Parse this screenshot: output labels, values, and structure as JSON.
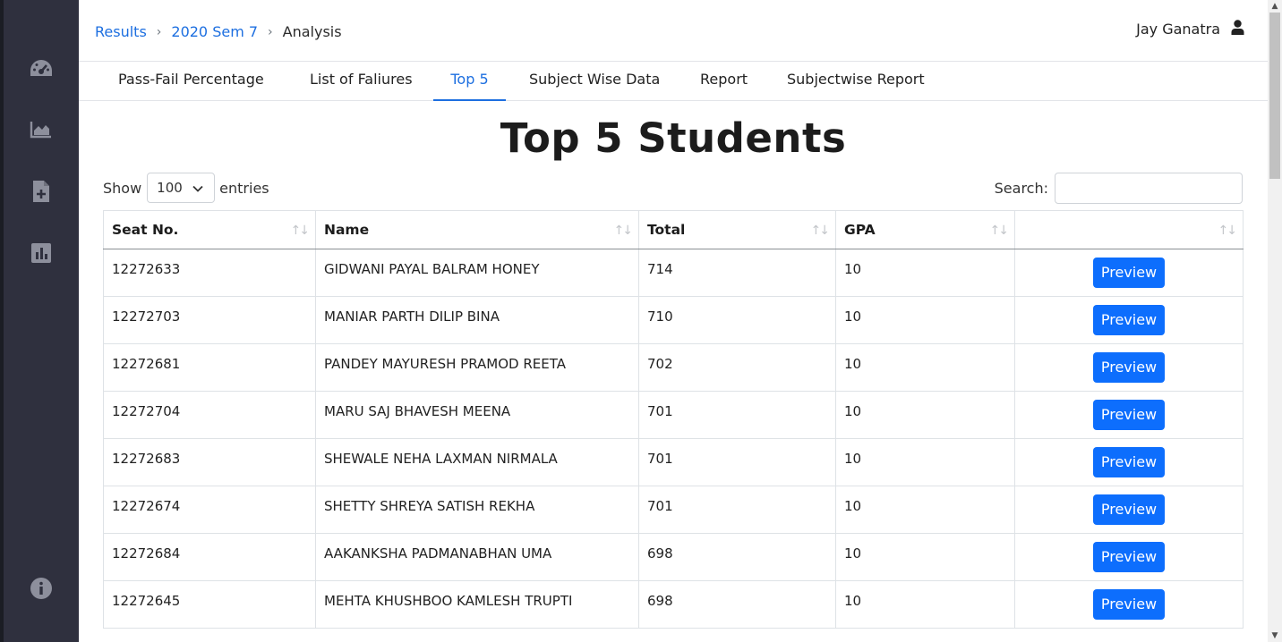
{
  "sidebar": {
    "items": [
      {
        "icon": "dashboard-icon"
      },
      {
        "icon": "area-chart-icon"
      },
      {
        "icon": "file-add-icon"
      },
      {
        "icon": "bar-chart-icon"
      },
      {
        "icon": "info-icon"
      }
    ]
  },
  "breadcrumb": {
    "items": [
      "Results",
      "2020 Sem 7"
    ],
    "current": "Analysis",
    "separator": "›"
  },
  "user": {
    "name": "Jay Ganatra",
    "icon": "user-icon"
  },
  "tabs": [
    {
      "label": "Pass-Fail Percentage",
      "active": false
    },
    {
      "label": "List of Faliures",
      "active": false
    },
    {
      "label": "Top 5",
      "active": true
    },
    {
      "label": "Subject Wise Data",
      "active": false
    },
    {
      "label": "Report",
      "active": false
    },
    {
      "label": "Subjectwise Report",
      "active": false
    }
  ],
  "page_title": "Top 5 Students",
  "length_control": {
    "prefix": "Show",
    "value": "100",
    "suffix": "entries"
  },
  "search": {
    "label": "Search:",
    "value": ""
  },
  "table": {
    "columns": [
      "Seat No.",
      "Name",
      "Total",
      "GPA",
      ""
    ],
    "action_label": "Preview",
    "rows": [
      [
        "12272633",
        "GIDWANI PAYAL BALRAM HONEY",
        "714",
        "10"
      ],
      [
        "12272703",
        "MANIAR PARTH DILIP BINA",
        "710",
        "10"
      ],
      [
        "12272681",
        "PANDEY MAYURESH PRAMOD REETA",
        "702",
        "10"
      ],
      [
        "12272704",
        "MARU SAJ BHAVESH MEENA",
        "701",
        "10"
      ],
      [
        "12272683",
        "SHEWALE NEHA LAXMAN NIRMALA",
        "701",
        "10"
      ],
      [
        "12272674",
        "SHETTY SHREYA SATISH REKHA",
        "701",
        "10"
      ],
      [
        "12272684",
        "AAKANKSHA PADMANABHAN UMA",
        "698",
        "10"
      ],
      [
        "12272645",
        "MEHTA KHUSHBOO KAMLESH TRUPTI",
        "698",
        "10"
      ]
    ]
  },
  "colors": {
    "sidebar_bg": "#2f303e",
    "accent": "#1d6fe0",
    "button": "#0d6efd"
  }
}
